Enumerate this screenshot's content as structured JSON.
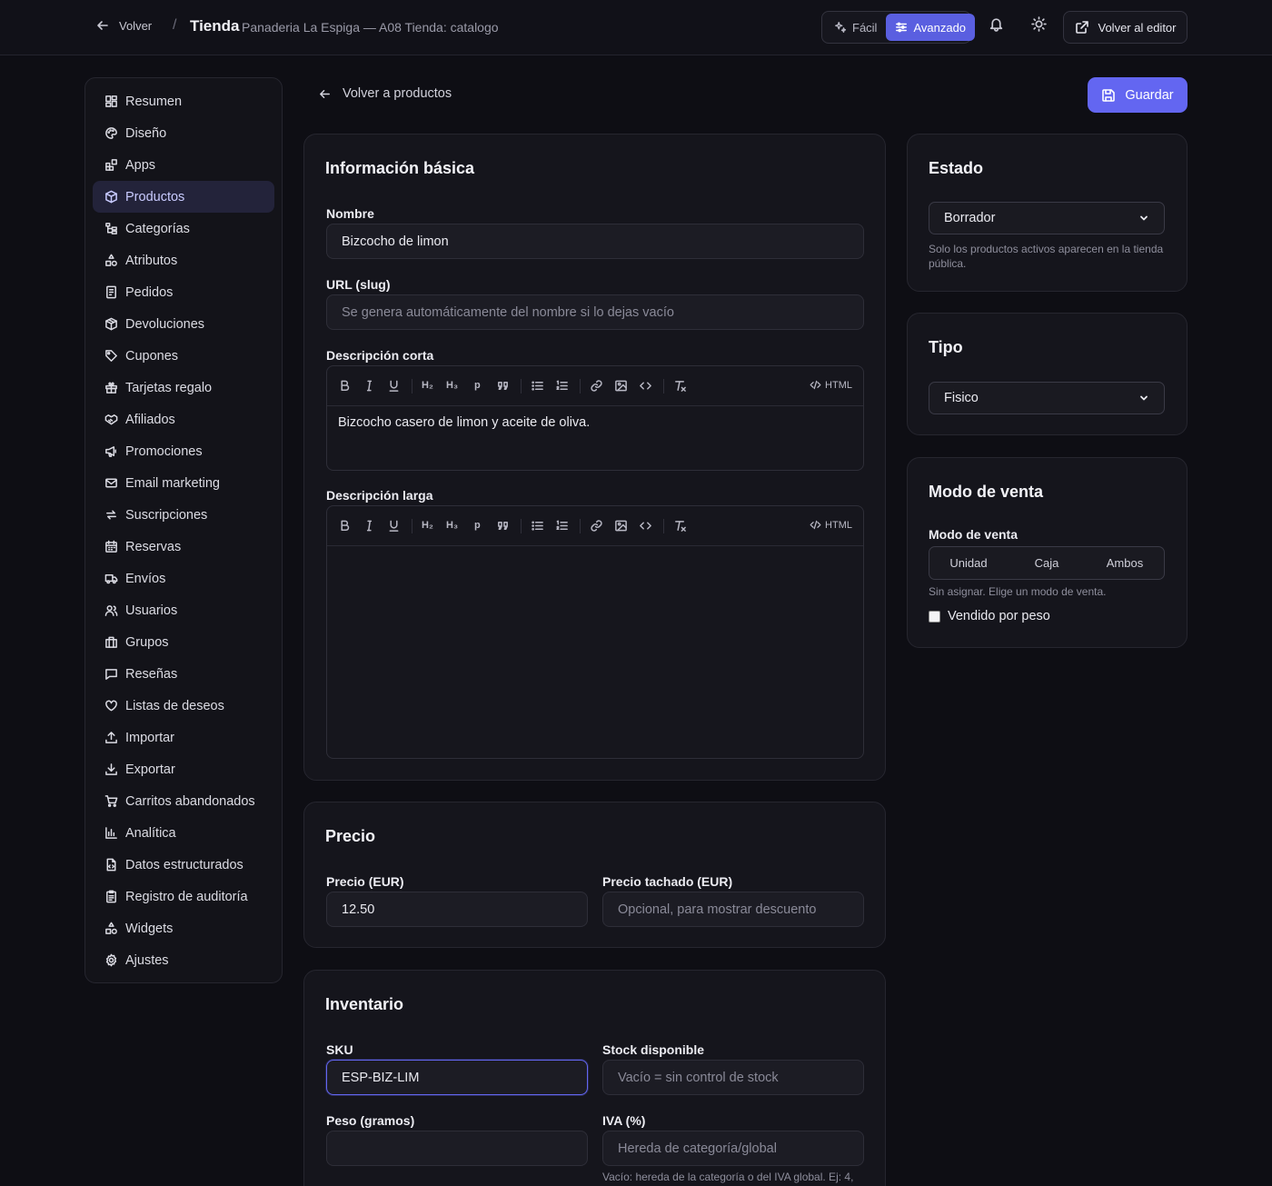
{
  "topbar": {
    "back_label": "Volver",
    "slash": "/",
    "title": "Tienda",
    "subtitle": "Panaderia La Espiga — A08 Tienda: catalogo",
    "mode_easy": "Fácil",
    "mode_advanced": "Avanzado",
    "editor_button": "Volver al editor"
  },
  "sidebar": {
    "items": [
      {
        "label": "Resumen",
        "icon": "dashboard-icon"
      },
      {
        "label": "Diseño",
        "icon": "palette-icon"
      },
      {
        "label": "Apps",
        "icon": "apps-icon"
      },
      {
        "label": "Productos",
        "icon": "box-icon"
      },
      {
        "label": "Categorías",
        "icon": "tree-icon"
      },
      {
        "label": "Atributos",
        "icon": "shapes-icon"
      },
      {
        "label": "Pedidos",
        "icon": "receipt-icon"
      },
      {
        "label": "Devoluciones",
        "icon": "package-return-icon"
      },
      {
        "label": "Cupones",
        "icon": "tag-icon"
      },
      {
        "label": "Tarjetas regalo",
        "icon": "gift-icon"
      },
      {
        "label": "Afiliados",
        "icon": "handshake-icon"
      },
      {
        "label": "Promociones",
        "icon": "megaphone-icon"
      },
      {
        "label": "Email marketing",
        "icon": "mail-icon"
      },
      {
        "label": "Suscripciones",
        "icon": "repeat-icon"
      },
      {
        "label": "Reservas",
        "icon": "calendar-icon"
      },
      {
        "label": "Envíos",
        "icon": "truck-icon"
      },
      {
        "label": "Usuarios",
        "icon": "users-icon"
      },
      {
        "label": "Grupos",
        "icon": "building-icon"
      },
      {
        "label": "Reseñas",
        "icon": "message-icon"
      },
      {
        "label": "Listas de deseos",
        "icon": "heart-icon"
      },
      {
        "label": "Importar",
        "icon": "upload-icon"
      },
      {
        "label": "Exportar",
        "icon": "download-icon"
      },
      {
        "label": "Carritos abandonados",
        "icon": "cart-icon"
      },
      {
        "label": "Analítica",
        "icon": "bar-chart-icon"
      },
      {
        "label": "Datos estructurados",
        "icon": "file-code-icon"
      },
      {
        "label": "Registro de auditoría",
        "icon": "clipboard-icon"
      },
      {
        "label": "Widgets",
        "icon": "shapes-icon"
      },
      {
        "label": "Ajustes",
        "icon": "gear-icon"
      }
    ]
  },
  "main": {
    "back_products": "Volver a productos",
    "save_label": "Guardar",
    "basic": {
      "title": "Información básica",
      "name_label": "Nombre",
      "name_value": "Bizcocho de limon",
      "slug_label": "URL (slug)",
      "slug_placeholder": "Se genera automáticamente del nombre si lo dejas vacío",
      "short_label": "Descripción corta",
      "short_value": "Bizcocho casero de limon y aceite de oliva.",
      "long_label": "Descripción larga",
      "long_value": ""
    },
    "toolbar": {
      "h2": "H₂",
      "h3": "H₃",
      "p": "p",
      "html": "HTML"
    },
    "price": {
      "title": "Precio",
      "price_label": "Precio (EUR)",
      "price_value": "12.50",
      "compare_label": "Precio tachado (EUR)",
      "compare_placeholder": "Opcional, para mostrar descuento"
    },
    "inventory": {
      "title": "Inventario",
      "sku_label": "SKU",
      "sku_value": "ESP-BIZ-LIM",
      "stock_label": "Stock disponible",
      "stock_placeholder": "Vacío = sin control de stock",
      "weight_label": "Peso (gramos)",
      "weight_value": "",
      "vat_label": "IVA (%)",
      "vat_placeholder": "Hereda de categoría/global",
      "vat_help": "Vacío: hereda de la categoría o del IVA global. Ej: 4,"
    }
  },
  "aside": {
    "status": {
      "title": "Estado",
      "value": "Borrador",
      "help": "Solo los productos activos aparecen en la tienda pública."
    },
    "type": {
      "title": "Tipo",
      "value": "Fisico"
    },
    "sale_mode": {
      "title": "Modo de venta",
      "label": "Modo de venta",
      "options": [
        "Unidad",
        "Caja",
        "Ambos"
      ],
      "help": "Sin asignar. Elige un modo de venta.",
      "by_weight_label": "Vendido por peso"
    }
  },
  "colors": {
    "accent": "#6366f1",
    "background": "#0e0e14",
    "card": "#15151c"
  }
}
